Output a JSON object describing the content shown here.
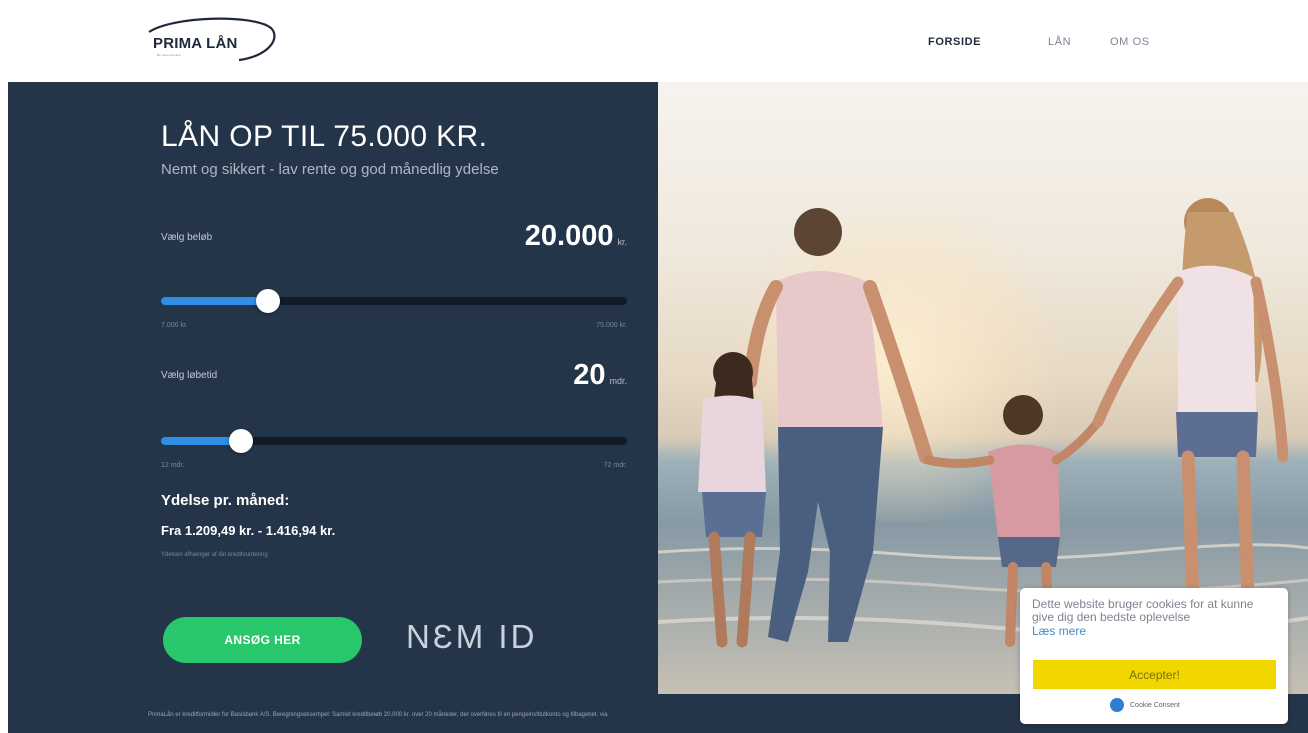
{
  "brand": {
    "name": "PRIMA LÅN",
    "tagline": "lån med overskud"
  },
  "nav": {
    "items": [
      {
        "label": "FORSIDE",
        "active": true
      },
      {
        "label": "LÅN",
        "active": false
      },
      {
        "label": "OM OS",
        "active": false
      }
    ]
  },
  "hero": {
    "headline": "LÅN OP TIL 75.000 KR.",
    "subheadline": "Nemt og sikkert - lav rente og god månedlig ydelse"
  },
  "amount_slider": {
    "label": "Vælg beløb",
    "value": "20.000",
    "unit": "kr.",
    "min_label": "7.000 kr.",
    "max_label": "75.000 kr.",
    "min": 7000,
    "max": 75000,
    "current": 20000
  },
  "term_slider": {
    "label": "Vælg løbetid",
    "value": "20",
    "unit": "mdr.",
    "min_label": "12 mdr.",
    "max_label": "72 mdr.",
    "min": 12,
    "max": 72,
    "current": 20
  },
  "monthly": {
    "title": "Ydelse pr. måned:",
    "range": "Fra 1.209,49 kr. - 1.416,94 kr.",
    "note": "Ydelsen afhænger af din kreditvurdering"
  },
  "cta": {
    "apply_label": "ANSØG HER",
    "nemid_label": "NƐM ID"
  },
  "footer": {
    "text": "PrimaLån er kreditformidler for Basisbank A/S. Beregningseksempel: Samlet kreditbeløb 20.000 kr. over 20 måneder, der overføres til en pengeinstitutkonto og tilbagebet. via"
  },
  "cookie": {
    "message": "Dette website bruger cookies for at kunne give dig den bedste oplevelse",
    "link_label": "Læs mere",
    "accept_label": "Accepter!",
    "brand_label": "Cookie Consent"
  },
  "colors": {
    "panel": "#253549",
    "slider_fill": "#2f8ee5",
    "apply_button": "#28c76c",
    "cookie_button": "#f1d600"
  }
}
